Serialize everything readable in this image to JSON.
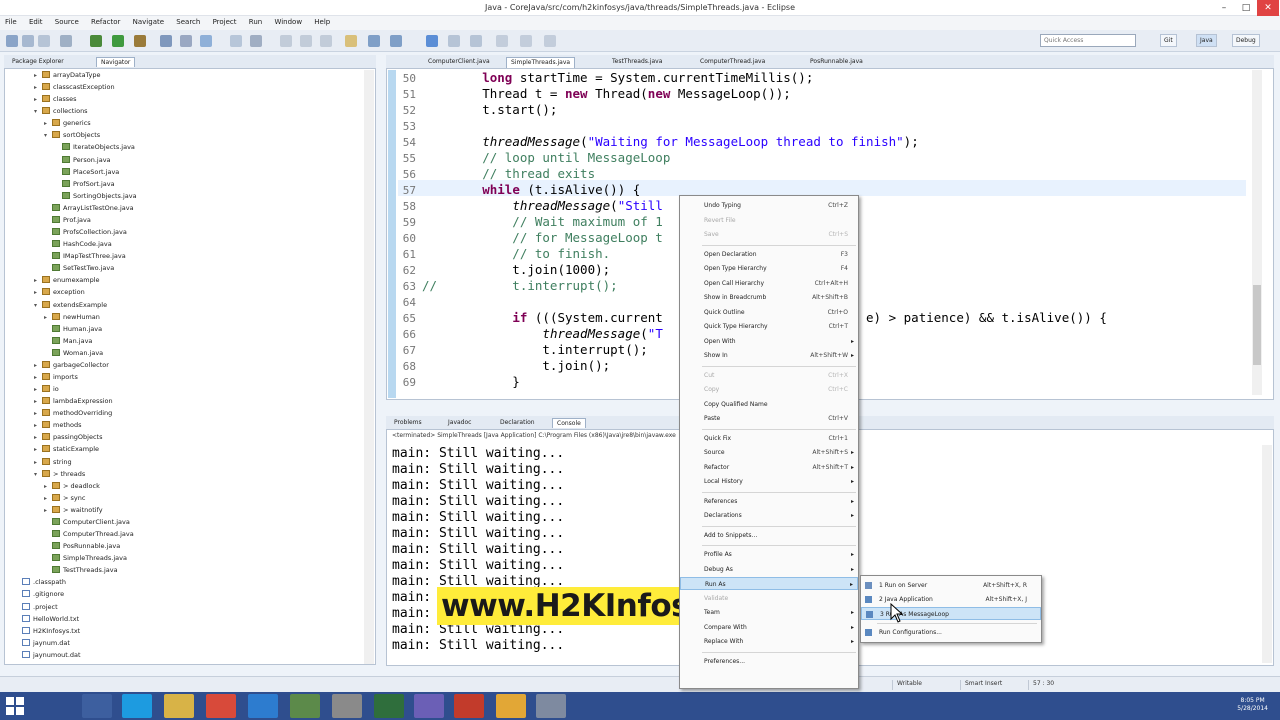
{
  "window": {
    "title": "Java - CoreJava/src/com/h2kinfosys/java/threads/SimpleThreads.java - Eclipse"
  },
  "menu": [
    "File",
    "Edit",
    "Source",
    "Refactor",
    "Navigate",
    "Search",
    "Project",
    "Run",
    "Window",
    "Help"
  ],
  "toolbar": {
    "quick_access_placeholder": "Quick Access",
    "perspectives": [
      "Git",
      "Java",
      "Debug"
    ]
  },
  "left_panel": {
    "tabs": [
      "Package Explorer",
      "Navigator"
    ],
    "tree": [
      {
        "label": "arrayDataType",
        "depth": 3,
        "kind": "folder",
        "twist": "▸"
      },
      {
        "label": "classcastException",
        "depth": 3,
        "kind": "folder",
        "twist": "▸"
      },
      {
        "label": "classes",
        "depth": 3,
        "kind": "folder",
        "twist": "▸"
      },
      {
        "label": "collections",
        "depth": 3,
        "kind": "folder",
        "twist": "▾"
      },
      {
        "label": "generics",
        "depth": 4,
        "kind": "folder",
        "twist": "▸"
      },
      {
        "label": "sortObjects",
        "depth": 4,
        "kind": "folder",
        "twist": "▾"
      },
      {
        "label": "IterateObjects.java",
        "depth": 5,
        "kind": "java",
        "twist": ""
      },
      {
        "label": "Person.java",
        "depth": 5,
        "kind": "java",
        "twist": ""
      },
      {
        "label": "PlaceSort.java",
        "depth": 5,
        "kind": "java",
        "twist": ""
      },
      {
        "label": "ProfSort.java",
        "depth": 5,
        "kind": "java",
        "twist": ""
      },
      {
        "label": "SortingObjects.java",
        "depth": 5,
        "kind": "java",
        "twist": ""
      },
      {
        "label": "ArrayListTestOne.java",
        "depth": 4,
        "kind": "java",
        "twist": ""
      },
      {
        "label": "Prof.java",
        "depth": 4,
        "kind": "java",
        "twist": ""
      },
      {
        "label": "ProfsCollection.java",
        "depth": 4,
        "kind": "java",
        "twist": ""
      },
      {
        "label": "HashCode.java",
        "depth": 4,
        "kind": "java",
        "twist": ""
      },
      {
        "label": "IMapTestThree.java",
        "depth": 4,
        "kind": "java",
        "twist": ""
      },
      {
        "label": "SetTestTwo.java",
        "depth": 4,
        "kind": "java",
        "twist": ""
      },
      {
        "label": "enumexample",
        "depth": 3,
        "kind": "folder",
        "twist": "▸"
      },
      {
        "label": "exception",
        "depth": 3,
        "kind": "folder",
        "twist": "▸"
      },
      {
        "label": "extendsExample",
        "depth": 3,
        "kind": "folder",
        "twist": "▾"
      },
      {
        "label": "newHuman",
        "depth": 4,
        "kind": "folder",
        "twist": "▸"
      },
      {
        "label": "Human.java",
        "depth": 4,
        "kind": "java",
        "twist": ""
      },
      {
        "label": "Man.java",
        "depth": 4,
        "kind": "java",
        "twist": ""
      },
      {
        "label": "Woman.java",
        "depth": 4,
        "kind": "java",
        "twist": ""
      },
      {
        "label": "garbageCollector",
        "depth": 3,
        "kind": "folder",
        "twist": "▸"
      },
      {
        "label": "imports",
        "depth": 3,
        "kind": "folder",
        "twist": "▸"
      },
      {
        "label": "io",
        "depth": 3,
        "kind": "folder",
        "twist": "▸"
      },
      {
        "label": "lambdaExpression",
        "depth": 3,
        "kind": "folder",
        "twist": "▸"
      },
      {
        "label": "methodOverriding",
        "depth": 3,
        "kind": "folder",
        "twist": "▸"
      },
      {
        "label": "methods",
        "depth": 3,
        "kind": "folder",
        "twist": "▸"
      },
      {
        "label": "passingObjects",
        "depth": 3,
        "kind": "folder",
        "twist": "▸"
      },
      {
        "label": "staticExample",
        "depth": 3,
        "kind": "folder",
        "twist": "▸"
      },
      {
        "label": "string",
        "depth": 3,
        "kind": "folder",
        "twist": "▸"
      },
      {
        "label": "> threads",
        "depth": 3,
        "kind": "folder",
        "twist": "▾"
      },
      {
        "label": "> deadlock",
        "depth": 4,
        "kind": "folder",
        "twist": "▸"
      },
      {
        "label": "> sync",
        "depth": 4,
        "kind": "folder",
        "twist": "▸"
      },
      {
        "label": "> waitnotify",
        "depth": 4,
        "kind": "folder",
        "twist": "▸"
      },
      {
        "label": "ComputerClient.java",
        "depth": 4,
        "kind": "java",
        "twist": ""
      },
      {
        "label": "ComputerThread.java",
        "depth": 4,
        "kind": "java",
        "twist": ""
      },
      {
        "label": "PosRunnable.java",
        "depth": 4,
        "kind": "java",
        "twist": ""
      },
      {
        "label": "SimpleThreads.java",
        "depth": 4,
        "kind": "java",
        "twist": ""
      },
      {
        "label": "TestThreads.java",
        "depth": 4,
        "kind": "java",
        "twist": ""
      },
      {
        "label": ".classpath",
        "depth": 1,
        "kind": "file",
        "twist": ""
      },
      {
        "label": ".gitignore",
        "depth": 1,
        "kind": "file",
        "twist": ""
      },
      {
        "label": ".project",
        "depth": 1,
        "kind": "file",
        "twist": ""
      },
      {
        "label": "HelloWorld.txt",
        "depth": 1,
        "kind": "file",
        "twist": ""
      },
      {
        "label": "H2KInfosys.txt",
        "depth": 1,
        "kind": "file",
        "twist": ""
      },
      {
        "label": "jaynum.dat",
        "depth": 1,
        "kind": "file",
        "twist": ""
      },
      {
        "label": "jaynumout.dat",
        "depth": 1,
        "kind": "file",
        "twist": ""
      }
    ]
  },
  "editor": {
    "tabs": [
      {
        "label": "ComputerClient.java",
        "active": false
      },
      {
        "label": "SimpleThreads.java",
        "active": true
      },
      {
        "label": "TestThreads.java",
        "active": false
      },
      {
        "label": "ComputerThread.java",
        "active": false
      },
      {
        "label": "PosRunnable.java",
        "active": false
      }
    ],
    "line_numbers": [
      "50",
      "51",
      "52",
      "53",
      "54",
      "55",
      "56",
      "57",
      "58",
      "59",
      "60",
      "61",
      "62",
      "63",
      "64",
      "65",
      "66",
      "67",
      "68",
      "69"
    ],
    "lines": [
      "        long startTime = System.currentTimeMillis();",
      "        Thread t = new Thread(new MessageLoop());",
      "        t.start();",
      "",
      "        threadMessage(\"Waiting for MessageLoop thread to finish\");",
      "        // loop until MessageLoop",
      "        // thread exits",
      "        while (t.isAlive()) {",
      "            threadMessage(\"Still",
      "            // Wait maximum of 1",
      "            // for MessageLoop t",
      "            // to finish.",
      "            t.join(1000);",
      "//          t.interrupt();",
      "",
      "            if (((System.current                           e) > patience) && t.isAlive()) {",
      "                threadMessage(\"T",
      "                t.interrupt();",
      "                t.join();",
      "            }"
    ]
  },
  "console": {
    "tabs": [
      "Problems",
      "Javadoc",
      "Declaration",
      "Console"
    ],
    "header": "<terminated> SimpleThreads [Java Application] C:\\Program Files (x86)\\Java\\jre8\\bin\\javaw.exe",
    "lines": [
      "main: Still waiting...",
      "main: Still waiting...",
      "main: Still waiting...",
      "main: Still waiting...",
      "main: Still waiting...",
      "main: Still waiting...",
      "main: Still waiting...",
      "main: Still waiting...",
      "main: Still waiting...",
      "main: Still waiting...",
      "main: Still waiting...",
      "main: Still waiting...",
      "main: Still waiting..."
    ]
  },
  "context_menu": {
    "items": [
      {
        "label": "Undo Typing",
        "shortcut": "Ctrl+Z",
        "disabled": false,
        "arrow": false
      },
      {
        "label": "Revert File",
        "shortcut": "",
        "disabled": true,
        "arrow": false
      },
      {
        "label": "Save",
        "shortcut": "Ctrl+S",
        "disabled": true,
        "arrow": false
      },
      {
        "sep": true
      },
      {
        "label": "Open Declaration",
        "shortcut": "F3",
        "disabled": false,
        "arrow": false
      },
      {
        "label": "Open Type Hierarchy",
        "shortcut": "F4",
        "disabled": false,
        "arrow": false
      },
      {
        "label": "Open Call Hierarchy",
        "shortcut": "Ctrl+Alt+H",
        "disabled": false,
        "arrow": false
      },
      {
        "label": "Show in Breadcrumb",
        "shortcut": "Alt+Shift+B",
        "disabled": false,
        "arrow": false
      },
      {
        "label": "Quick Outline",
        "shortcut": "Ctrl+O",
        "disabled": false,
        "arrow": false
      },
      {
        "label": "Quick Type Hierarchy",
        "shortcut": "Ctrl+T",
        "disabled": false,
        "arrow": false
      },
      {
        "label": "Open With",
        "shortcut": "",
        "disabled": false,
        "arrow": true
      },
      {
        "label": "Show In",
        "shortcut": "Alt+Shift+W",
        "disabled": false,
        "arrow": true
      },
      {
        "sep": true
      },
      {
        "label": "Cut",
        "shortcut": "Ctrl+X",
        "disabled": true,
        "arrow": false
      },
      {
        "label": "Copy",
        "shortcut": "Ctrl+C",
        "disabled": true,
        "arrow": false
      },
      {
        "label": "Copy Qualified Name",
        "shortcut": "",
        "disabled": false,
        "arrow": false
      },
      {
        "label": "Paste",
        "shortcut": "Ctrl+V",
        "disabled": false,
        "arrow": false
      },
      {
        "sep": true
      },
      {
        "label": "Quick Fix",
        "shortcut": "Ctrl+1",
        "disabled": false,
        "arrow": false
      },
      {
        "label": "Source",
        "shortcut": "Alt+Shift+S",
        "disabled": false,
        "arrow": true
      },
      {
        "label": "Refactor",
        "shortcut": "Alt+Shift+T",
        "disabled": false,
        "arrow": true
      },
      {
        "label": "Local History",
        "shortcut": "",
        "disabled": false,
        "arrow": true
      },
      {
        "sep": true
      },
      {
        "label": "References",
        "shortcut": "",
        "disabled": false,
        "arrow": true
      },
      {
        "label": "Declarations",
        "shortcut": "",
        "disabled": false,
        "arrow": true
      },
      {
        "sep": true
      },
      {
        "label": "Add to Snippets...",
        "shortcut": "",
        "disabled": false,
        "arrow": false
      },
      {
        "sep": true
      },
      {
        "label": "Profile As",
        "shortcut": "",
        "disabled": false,
        "arrow": true
      },
      {
        "label": "Debug As",
        "shortcut": "",
        "disabled": false,
        "arrow": true
      },
      {
        "label": "Run As",
        "shortcut": "",
        "disabled": false,
        "arrow": true,
        "highlight": true
      },
      {
        "label": "Validate",
        "shortcut": "",
        "disabled": true,
        "arrow": false
      },
      {
        "label": "Team",
        "shortcut": "",
        "disabled": false,
        "arrow": true
      },
      {
        "label": "Compare With",
        "shortcut": "",
        "disabled": false,
        "arrow": true
      },
      {
        "label": "Replace With",
        "shortcut": "",
        "disabled": false,
        "arrow": true
      },
      {
        "sep": true
      },
      {
        "label": "Preferences...",
        "shortcut": "",
        "disabled": false,
        "arrow": false
      }
    ]
  },
  "submenu": {
    "items": [
      {
        "label": "1 Run on Server",
        "shortcut": "Alt+Shift+X, R",
        "highlight": false
      },
      {
        "label": "2 Java Application",
        "shortcut": "Alt+Shift+X, J",
        "highlight": false
      },
      {
        "label": "3 Run As MessageLoop",
        "shortcut": "",
        "highlight": true
      },
      {
        "sep": true
      },
      {
        "label": "Run Configurations...",
        "shortcut": "",
        "highlight": false
      }
    ]
  },
  "watermark": "www.H2KInfosys.com",
  "status": {
    "writable": "Writable",
    "insert": "Smart Insert",
    "position": "57 : 30"
  },
  "clock": {
    "time": "8:05 PM",
    "date": "5/28/2014"
  },
  "colors": {
    "accent": "#2f4e8e",
    "highlight": "#cde4f7",
    "watermark_bg": "#ffec3a"
  }
}
